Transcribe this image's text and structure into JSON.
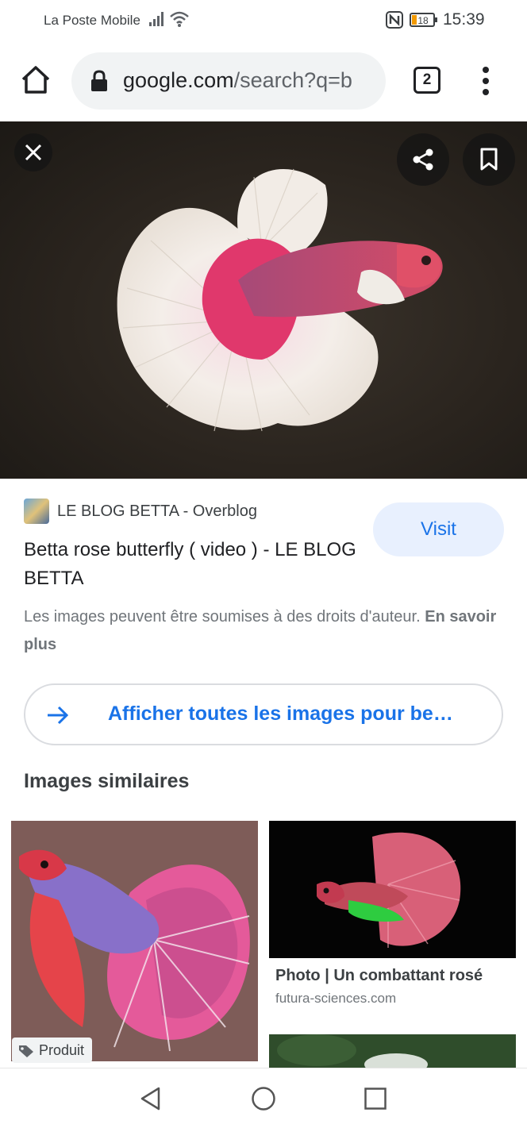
{
  "status_bar": {
    "carrier": "La Poste Mobile",
    "battery": "18",
    "time": "15:39"
  },
  "browser": {
    "url_host": "google.com",
    "url_path": "/search?q=b",
    "tab_count": "2",
    "icons": [
      "home-icon",
      "lock-icon",
      "more-vert-icon"
    ]
  },
  "viewer": {
    "icons": [
      "close-icon",
      "share-icon",
      "bookmark-icon"
    ]
  },
  "result": {
    "source": "LE BLOG BETTA - Overblog",
    "visit_label": "Visit",
    "title": "Betta rose butterfly ( video ) - LE BLOG BETTA",
    "copyright_text": "Les images peuvent être soumises à des droits d'auteur.",
    "learn_more": "En savoir plus",
    "view_all_label": "Afficher toutes les images pour be…"
  },
  "similar": {
    "heading": "Images similaires",
    "items": [
      {
        "badge": "Produit"
      },
      {
        "title": "Photo | Un combattant rosé",
        "source": "futura-sciences.com"
      }
    ]
  },
  "colors": {
    "link_blue": "#1a73e8",
    "visit_bg": "#e8f0fe",
    "omnibox_bg": "#f1f3f4"
  }
}
